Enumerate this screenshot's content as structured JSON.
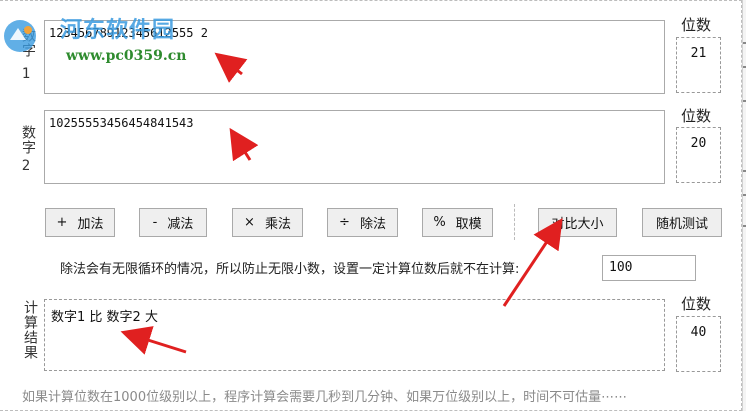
{
  "watermark": {
    "title": "河东软件园",
    "url": "www.pc0359.cn"
  },
  "number1": {
    "label_chars": "数字",
    "label_num": "1",
    "value": "12345678912345612555 2",
    "digits_label": "位数",
    "digits_value": "21"
  },
  "number2": {
    "label_chars": "数字",
    "label_num": "2",
    "value": "10255553456454841543",
    "digits_label": "位数",
    "digits_value": "20"
  },
  "buttons": {
    "add": {
      "icon": "+",
      "label": "加法"
    },
    "sub": {
      "icon": "-",
      "label": "减法"
    },
    "mul": {
      "icon": "×",
      "label": "乘法"
    },
    "div": {
      "icon": "÷",
      "label": "除法"
    },
    "mod": {
      "icon": "%",
      "label": "取模"
    },
    "compare": "对比大小",
    "random_test": "随机测试"
  },
  "precision": {
    "note": "除法会有无限循环的情况，所以防止无限小数，设置一定计算位数后就不在计算:",
    "value": "100"
  },
  "result": {
    "label": "计算结果",
    "value": "数字1 比 数字2 大",
    "digits_label": "位数",
    "digits_value": "40"
  },
  "footer": {
    "text": "如果计算位数在1000位级别以上，程序计算会需要几秒到几分钟、如果万位级别以上，时间不可估量⋯⋯"
  },
  "colors": {
    "arrow": "#e02020",
    "watermark_blue": "#3a9be0",
    "watermark_green": "#2e8b2e"
  }
}
